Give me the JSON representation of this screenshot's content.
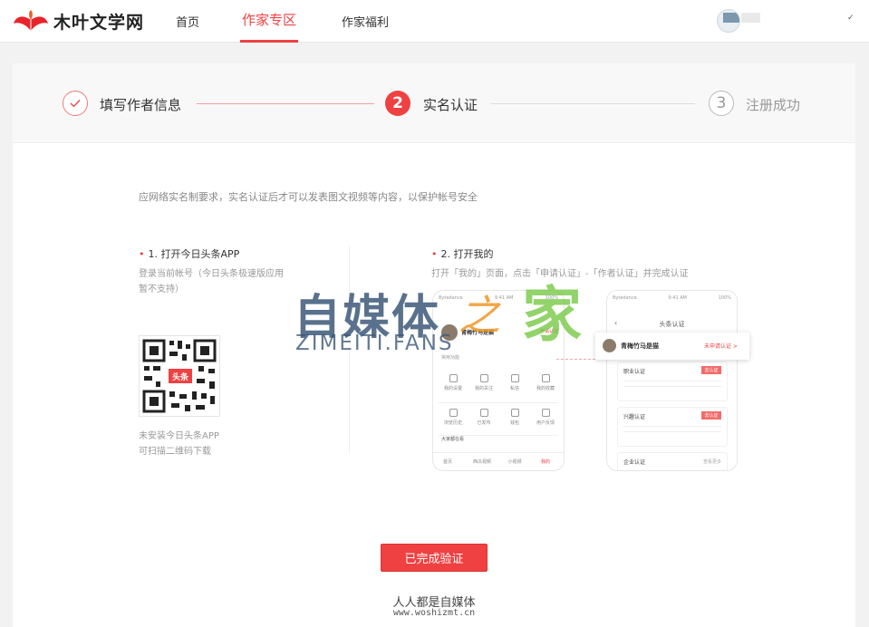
{
  "brand": {
    "name": "木叶文学网",
    "accent": "#f04142"
  },
  "nav": {
    "items": [
      {
        "label": "首页"
      },
      {
        "label": "作家专区"
      },
      {
        "label": "作家福利"
      }
    ],
    "active_index": 1,
    "dropdown_icon": "chevron-down-icon"
  },
  "steps": [
    {
      "label": "填写作者信息",
      "state": "done",
      "icon": "check-icon"
    },
    {
      "number": "2",
      "label": "实名认证",
      "state": "active"
    },
    {
      "number": "3",
      "label": "注册成功",
      "state": "todo"
    }
  ],
  "notice": "应网络实名制要求，实名认证后才可以发表图文视频等内容，以保护帐号安全",
  "section1": {
    "bullet": "•",
    "title": "1. 打开今日头条APP",
    "desc_line1": "登录当前帐号（今日头条极速版应用",
    "desc_line2": "暂不支持）",
    "qr_badge": "头条",
    "foot_line1": "未安装今日头条APP",
    "foot_line2": "可扫描二维码下载"
  },
  "section2": {
    "bullet": "•",
    "title": "2. 打开我的",
    "desc": "打开「我的」页面，点击「申请认证」-「作者认证」并完成认证"
  },
  "phone_left": {
    "carrier": "Bytedance",
    "time": "9:41 AM",
    "battery": "100%",
    "user": "青梅竹马是猫",
    "apply_link": "申请认证",
    "section_label": "常用功能",
    "grid_row1": [
      "我的设置",
      "我的关注",
      "私信",
      "我的收藏"
    ],
    "grid_row2": [
      "浏览历史",
      "已发布",
      "钱包",
      "用户反馈"
    ],
    "section_label2": "大家都在看",
    "tabs": [
      "首页",
      "西瓜视频",
      "小视频",
      "我的"
    ]
  },
  "phone_right": {
    "carrier": "Bytedance",
    "time": "9:41 AM",
    "battery": "100%",
    "back_icon": "back-arrow-icon",
    "title": "头条认证",
    "certs": [
      {
        "label": "职业认证",
        "button": "去认证"
      },
      {
        "label": "兴趣认证",
        "button": "去认证"
      },
      {
        "label": "企业认证",
        "button": "查看更多"
      }
    ]
  },
  "popup": {
    "user": "青梅竹马是猫",
    "link": "未申请认证 >"
  },
  "watermark": {
    "zh1": "自媒体",
    "zh2": "家",
    "swirl": "之",
    "en": "ZIMEITI.FANS"
  },
  "confirm_button": "已完成验证",
  "footer": {
    "slogan": "人人都是自媒体",
    "url": "www.woshizmt.cn"
  }
}
